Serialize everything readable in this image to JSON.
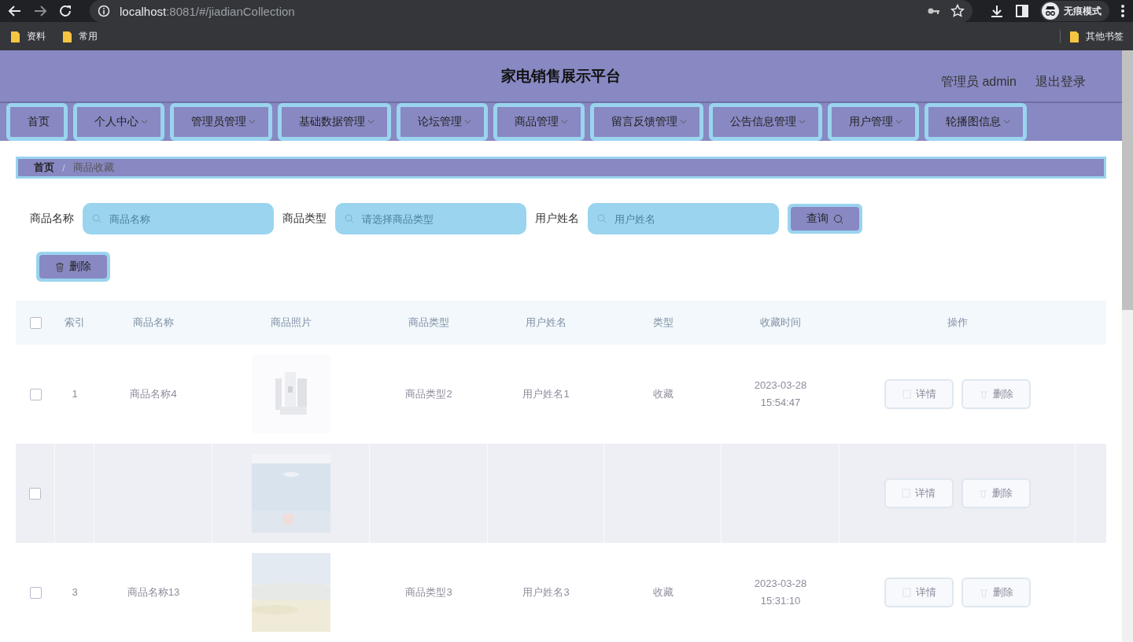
{
  "browser": {
    "url_host": "localhost",
    "url_rest": ":8081/#/jiadianCollection",
    "profile": "无痕模式",
    "bookmarks": [
      "资料",
      "常用"
    ],
    "other_bookmarks": "其他书签"
  },
  "header": {
    "title": "家电销售展示平台",
    "user": "管理员 admin",
    "logout": "退出登录"
  },
  "nav": [
    {
      "label": "首页",
      "dropdown": false
    },
    {
      "label": "个人中心",
      "dropdown": true
    },
    {
      "label": "管理员管理",
      "dropdown": true
    },
    {
      "label": "基础数据管理",
      "dropdown": true
    },
    {
      "label": "论坛管理",
      "dropdown": true
    },
    {
      "label": "商品管理",
      "dropdown": true
    },
    {
      "label": "留言反馈管理",
      "dropdown": true
    },
    {
      "label": "公告信息管理",
      "dropdown": true
    },
    {
      "label": "用户管理",
      "dropdown": true
    },
    {
      "label": "轮播图信息",
      "dropdown": true
    }
  ],
  "breadcrumb": [
    "首页",
    "商品收藏"
  ],
  "breadcrumb_separator": "/",
  "filters": [
    {
      "label": "商品名称",
      "placeholder": "商品名称"
    },
    {
      "label": "商品类型",
      "placeholder": "请选择商品类型"
    },
    {
      "label": "用户姓名",
      "placeholder": "用户姓名"
    }
  ],
  "search_button": "查询",
  "delete_button": "删除",
  "table": {
    "select_all_checked": false,
    "columns": [
      "索引",
      "商品名称",
      "商品照片",
      "商品类型",
      "用户姓名",
      "类型",
      "收藏时间",
      "操作"
    ],
    "rows": [
      {
        "checked": false,
        "index": "1",
        "name": "商品名称4",
        "type": "商品类型2",
        "user": "用户姓名1",
        "collect_type": "收藏",
        "time": "2023-03-28 15:54:47",
        "actions": [
          "详情",
          "删除"
        ],
        "highlighted": false
      },
      {
        "checked": false,
        "actions": [
          "详情",
          "删除"
        ],
        "highlighted": true
      },
      {
        "checked": false,
        "index": "3",
        "name": "商品名称13",
        "type": "商品类型3",
        "user": "用户姓名3",
        "collect_type": "收藏",
        "time": "2023-03-28 15:31:10",
        "actions": [
          "详情",
          "删除"
        ],
        "highlighted": false
      }
    ]
  }
}
